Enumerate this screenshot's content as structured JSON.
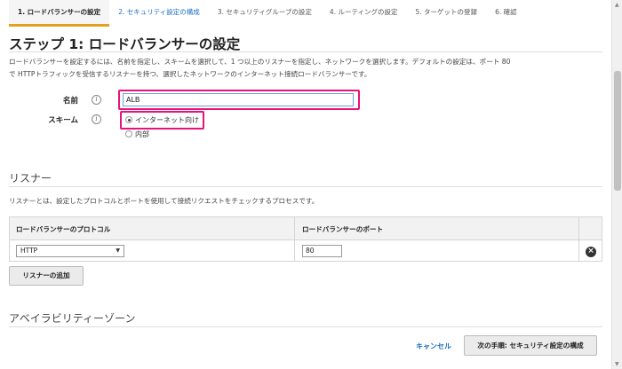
{
  "wizard": {
    "tabs": [
      {
        "label": "1. ロードバランサーの設定",
        "active": true
      },
      {
        "label": "2. セキュリティ設定の構成",
        "active": false
      },
      {
        "label": "3. セキュリティグループの設定",
        "active": false
      },
      {
        "label": "4. ルーティングの設定",
        "active": false
      },
      {
        "label": "5. ターゲットの登録",
        "active": false
      },
      {
        "label": "6. 確認",
        "active": false
      }
    ]
  },
  "page": {
    "title": "ステップ 1: ロードバランサーの設定",
    "description_line1": "ロードバランサーを設定するには、名前を指定し、スキームを選択して、1 つ以上のリスナーを指定し、ネットワークを選択します。デフォルトの設定は、ポート 80",
    "description_line2": "で HTTPトラフィックを受信するリスナーを持つ、選択したネットワークのインターネット接続ロードバランサーです。"
  },
  "form": {
    "name_label": "名前",
    "name_value": "ALB",
    "scheme_label": "スキーム",
    "scheme_options": [
      "インターネット向け",
      "内部"
    ],
    "scheme_selected": "インターネット向け",
    "info_icon_glyph": "i"
  },
  "listeners": {
    "title": "リスナー",
    "description": "リスナーとは、設定したプロトコルとポートを使用して接続リクエストをチェックするプロセスです。",
    "columns": [
      "ロードバランサーのプロトコル",
      "ロードバランサーのポート"
    ],
    "rows": [
      {
        "protocol": "HTTP",
        "port": "80"
      }
    ],
    "add_button": "リスナーの追加"
  },
  "availability_zones": {
    "title": "アベイラビリティーゾーン"
  },
  "footer": {
    "cancel_label": "キャンセル",
    "next_label": "次の手順: セキュリティ設定の構成"
  },
  "colors": {
    "highlight": "#e8127a",
    "active_tab_underline": "#e4a11b",
    "link": "#1a6fc1"
  }
}
